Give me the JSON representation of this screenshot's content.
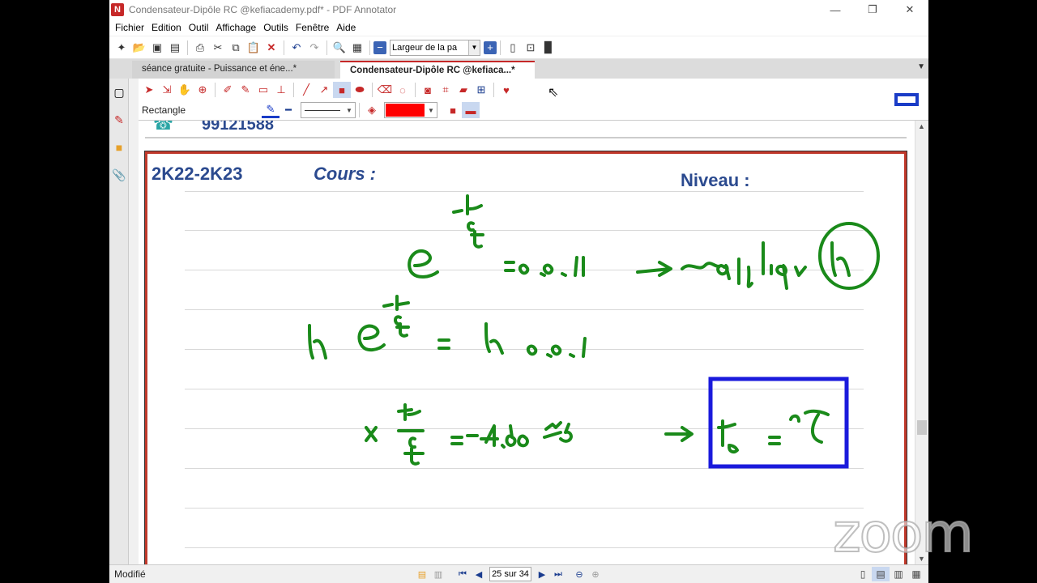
{
  "window": {
    "title": "Condensateur-Dipôle RC @kefiacademy.pdf* - PDF Annotator",
    "app_icon": "pdf-annotator-icon",
    "controls": {
      "minimize": "—",
      "maximize": "❐",
      "close": "✕"
    }
  },
  "menu": {
    "items": [
      "Fichier",
      "Edition",
      "Outil",
      "Affichage",
      "Outils",
      "Fenêtre",
      "Aide"
    ]
  },
  "toolbar": {
    "zoom_mode": "Largeur de la pa"
  },
  "tabs": [
    {
      "label": "séance gratuite - Puissance et éne...*",
      "active": false
    },
    {
      "label": "Condensateur-Dipôle RC @kefiaca...*",
      "active": true
    }
  ],
  "annotation_toolbar": {
    "current_tool": "Rectangle",
    "line_color": "#1a3cc7",
    "fill_color": "#ff0000"
  },
  "page": {
    "previous_page_phone": "99121588",
    "header_year": "2K22-2K23",
    "header_cours": "Cours :",
    "header_niveau": "Niveau :"
  },
  "statusbar": {
    "status": "Modifié",
    "page_indicator": "25 sur 34"
  },
  "watermark": "zoom",
  "colors": {
    "ink_green": "#1a8a1a",
    "box_blue": "#1a1adc",
    "accent_red": "#c62828",
    "header_blue": "#2b4a8f"
  }
}
